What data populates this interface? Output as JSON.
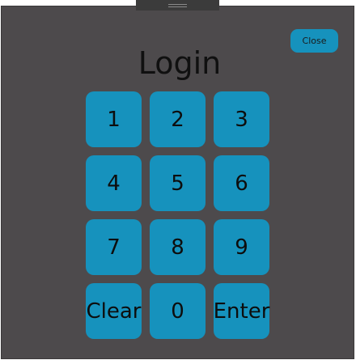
{
  "window": {
    "close_label": "Close",
    "title": "Login"
  },
  "keypad": {
    "keys": [
      {
        "label": "1",
        "name": "key-1"
      },
      {
        "label": "2",
        "name": "key-2"
      },
      {
        "label": "3",
        "name": "key-3"
      },
      {
        "label": "4",
        "name": "key-4"
      },
      {
        "label": "5",
        "name": "key-5"
      },
      {
        "label": "6",
        "name": "key-6"
      },
      {
        "label": "7",
        "name": "key-7"
      },
      {
        "label": "8",
        "name": "key-8"
      },
      {
        "label": "9",
        "name": "key-9"
      },
      {
        "label": "Clear",
        "name": "clear-button"
      },
      {
        "label": "0",
        "name": "key-0"
      },
      {
        "label": "Enter",
        "name": "enter-button"
      }
    ]
  },
  "colors": {
    "background": "#4d4a4c",
    "accent": "#1692bd",
    "text": "#101010"
  }
}
